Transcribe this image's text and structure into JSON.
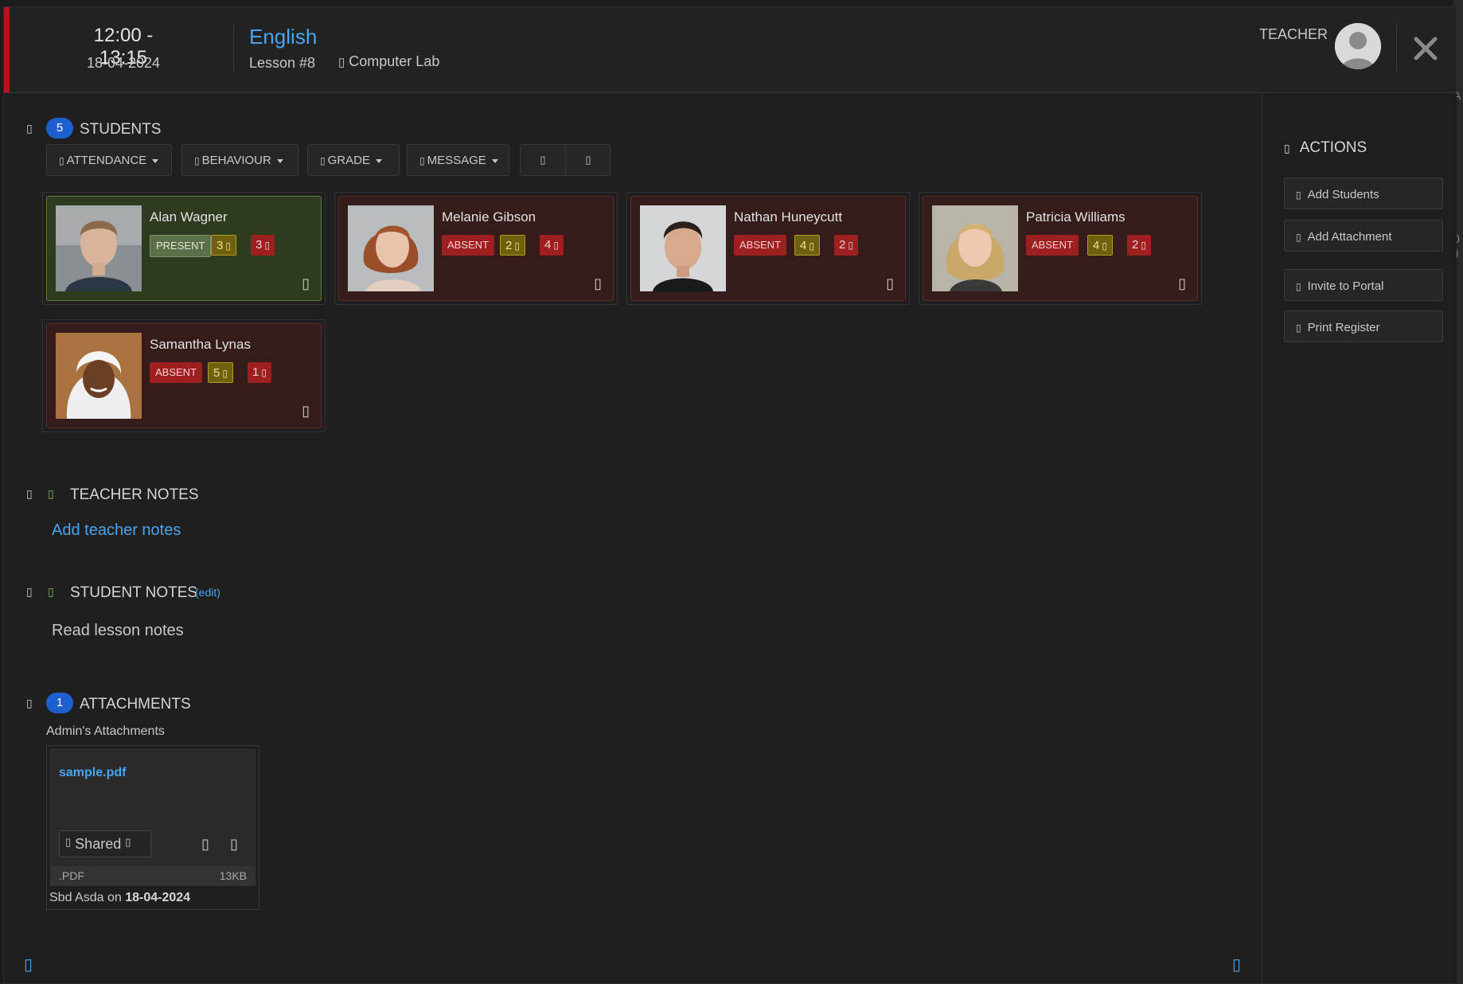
{
  "header": {
    "time_range": "12:00 - 13:15",
    "date": "18-04-2024",
    "subject": "English",
    "lesson": "Lesson #8",
    "room_icon": "▯",
    "room": "Computer Lab",
    "teacher_label": "TEACHER",
    "close_icon": "close-icon",
    "accent_color": "#b3141c"
  },
  "students": {
    "toggle_icon": "▯",
    "count": "5",
    "title": "STUDENTS",
    "filters": [
      {
        "icon": "▯",
        "label": "ATTENDANCE"
      },
      {
        "icon": "▯",
        "label": "BEHAVIOUR"
      },
      {
        "icon": "▯",
        "label": "GRADE"
      },
      {
        "icon": "▯",
        "label": "MESSAGE"
      }
    ],
    "group_buttons": [
      "▯",
      "▯"
    ],
    "list": [
      {
        "name": "Alan Wagner",
        "status": "PRESENT",
        "gold": "3",
        "red": "3",
        "icon": "▯"
      },
      {
        "name": "Melanie Gibson",
        "status": "ABSENT",
        "gold": "2",
        "red": "4",
        "icon": "▯"
      },
      {
        "name": "Nathan Huneycutt",
        "status": "ABSENT",
        "gold": "4",
        "red": "2",
        "icon": "▯"
      },
      {
        "name": "Patricia Williams",
        "status": "ABSENT",
        "gold": "4",
        "red": "2",
        "icon": "▯"
      },
      {
        "name": "Samantha Lynas",
        "status": "ABSENT",
        "gold": "5",
        "red": "1",
        "icon": "▯"
      }
    ],
    "pill_icon": "▯"
  },
  "teacher_notes": {
    "toggle_icon": "▯",
    "icon": "▯",
    "title": "TEACHER NOTES",
    "link": "Add teacher notes"
  },
  "student_notes": {
    "toggle_icon": "▯",
    "icon": "▯",
    "title": "STUDENT NOTES",
    "edit": "(edit)",
    "text": "Read lesson notes"
  },
  "attachments": {
    "toggle_icon": "▯",
    "count": "1",
    "title": "ATTACHMENTS",
    "subtitle": "Admin's Attachments",
    "file": {
      "name": "sample.pdf",
      "share_icon": "▯",
      "shared_label": "Shared",
      "share_caret_icon": "▯",
      "action_icons": [
        "▯",
        "▯"
      ],
      "ext": ".PDF",
      "size": "13KB",
      "uploader_prefix": "Sbd Asda on",
      "upload_date": "18-04-2024"
    }
  },
  "actions": {
    "icon": "▯",
    "title": "ACTIONS",
    "buttons": [
      {
        "icon": "▯",
        "label": "Add Students"
      },
      {
        "icon": "▯",
        "label": "Add Attachment"
      },
      {
        "icon": "▯",
        "label": "Invite to Portal"
      },
      {
        "icon": "▯",
        "label": "Print Register"
      }
    ]
  },
  "footer": {
    "left_icon": "▯",
    "right_icon": "▯"
  },
  "background_fragments": [
    "A",
    "1",
    "0",
    "li"
  ]
}
